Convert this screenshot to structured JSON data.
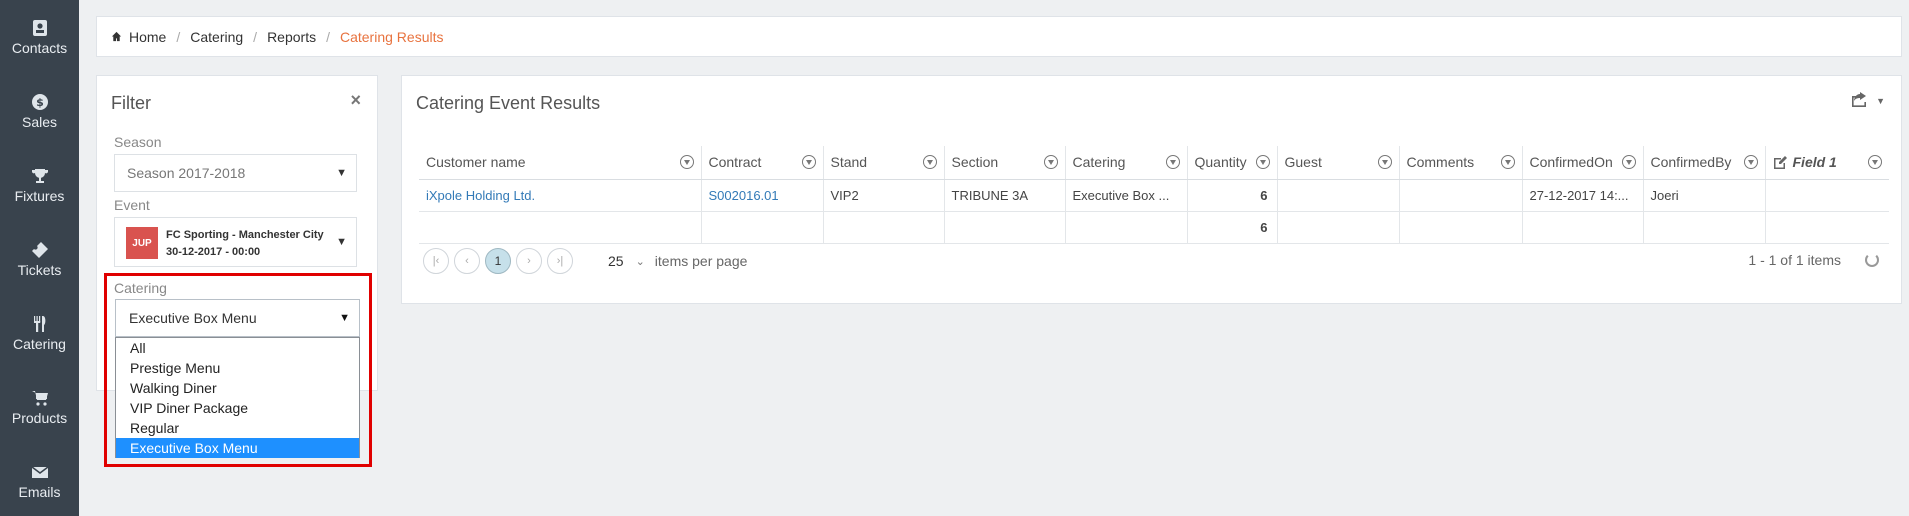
{
  "sidebar": {
    "items": [
      {
        "label": "Contacts",
        "icon": "contacts-icon"
      },
      {
        "label": "Sales",
        "icon": "dollar-icon"
      },
      {
        "label": "Fixtures",
        "icon": "trophy-icon"
      },
      {
        "label": "Tickets",
        "icon": "ticket-icon"
      },
      {
        "label": "Catering",
        "icon": "cutlery-icon"
      },
      {
        "label": "Products",
        "icon": "cart-icon"
      },
      {
        "label": "Emails",
        "icon": "envelope-icon"
      }
    ]
  },
  "breadcrumb": {
    "items": [
      "Home",
      "Catering",
      "Reports",
      "Catering Results"
    ],
    "active_color": "#e8733f"
  },
  "filter": {
    "title": "Filter",
    "close_glyph": "×",
    "season_label": "Season",
    "season_value": "Season 2017-2018",
    "event_label": "Event",
    "event_badge": "JUP",
    "event_match": "FC Sporting - Manchester City",
    "event_date": "30-12-2017 - 00:00",
    "catering_label": "Catering",
    "catering_value": "Executive Box Menu",
    "catering_options": [
      "All",
      "Prestige Menu",
      "Walking Diner",
      "VIP Diner Package",
      "Regular",
      "Executive Box Menu"
    ],
    "selected_option": "Executive Box Menu"
  },
  "results": {
    "title": "Catering Event Results",
    "columns": [
      "Customer name",
      "Contract",
      "Stand",
      "Section",
      "Catering",
      "Quantity",
      "Guest",
      "Comments",
      "ConfirmedOn",
      "ConfirmedBy",
      "Field 1"
    ],
    "rows": [
      [
        "iXpole Holding Ltd.",
        "S002016.01",
        "VIP2",
        "TRIBUNE 3A",
        "Executive Box ...",
        "6",
        "",
        "",
        "27-12-2017 14:...",
        "Joeri",
        ""
      ]
    ],
    "total_row": [
      "",
      "",
      "",
      "",
      "",
      "6",
      "",
      "",
      "",
      "",
      ""
    ],
    "pager": {
      "first": "|‹",
      "prev": "‹",
      "current_page": "1",
      "next": "›",
      "last": "›|",
      "page_size": "25",
      "page_size_label": "items per page",
      "info": "1 - 1 of 1 items"
    }
  }
}
